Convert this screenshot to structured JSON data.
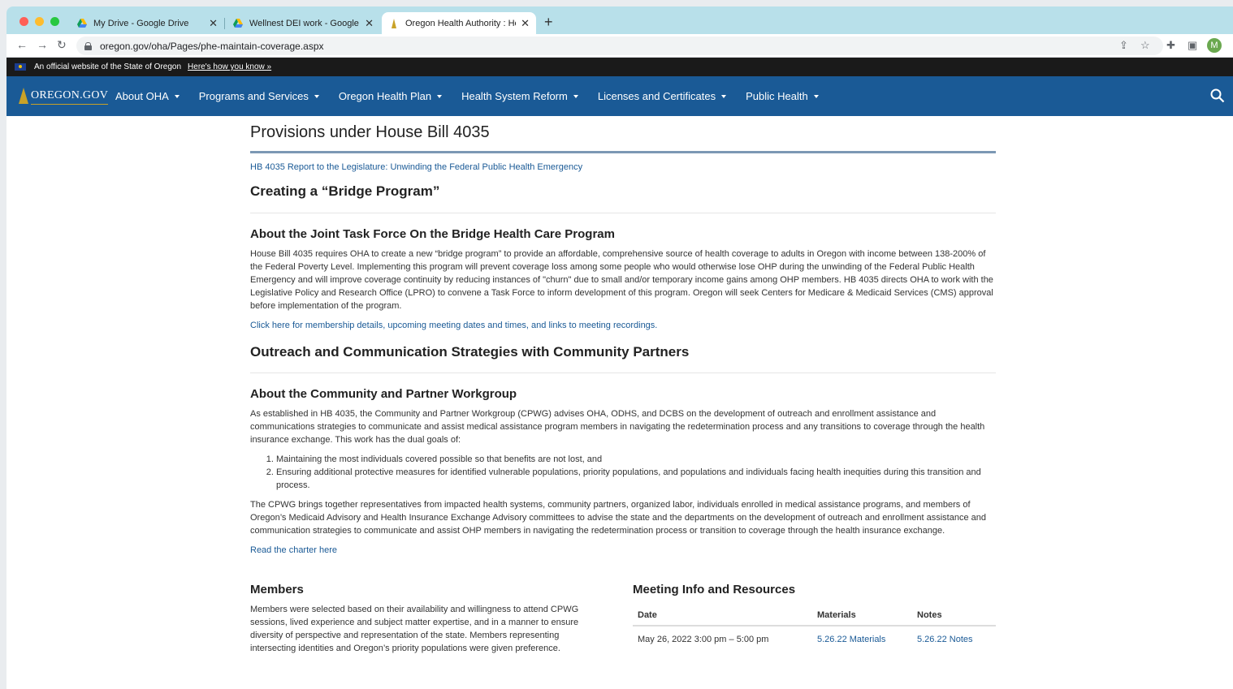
{
  "browser": {
    "tabs": [
      {
        "title": "My Drive - Google Drive",
        "active": false
      },
      {
        "title": "Wellnest DEI work - Google Dr",
        "active": false
      },
      {
        "title": "Oregon Health Authority : Help",
        "active": true
      }
    ],
    "new_tab": "+",
    "url": "oregon.gov/oha/Pages/phe-maintain-coverage.aspx",
    "avatar_letter": "M",
    "colors": {
      "tabstrip": "#b8e0ea",
      "avatar": "#6aa84f"
    }
  },
  "official_banner": {
    "text": "An official website of the State of Oregon",
    "link": "Here's how you know »"
  },
  "nav": {
    "logo_text": "OREGON.GOV",
    "items": [
      "About OHA",
      "Programs and Services",
      "Oregon Health Plan",
      "Health System Reform",
      "Licenses and Certificates",
      "Public Health"
    ],
    "color": "#1a5a96"
  },
  "content": {
    "title": "Provisions under House Bill 4035",
    "hb_link": "HB 4035 Report to the Legislature: Unwinding the Federal Public Health Emergency",
    "bridge_heading": "Creating a “Bridge Program”",
    "task_force_heading": "About the Joint Task Force On the Bridge Health Care Program",
    "task_force_text": "House Bill 4035 requires OHA to create a new “bridge program” to provide an affordable, comprehensive source of health coverage to adults in Oregon with income between 138-200% of the Federal Poverty Level. Implementing this program will prevent coverage loss among some people who would otherwise lose OHP during the unwinding of the Federal Public Health Emergency and will improve coverage continuity by reducing instances of \"churn\" due to small and/or temporary income gains among OHP members. HB 4035 directs OHA to work with the Legislative Policy and Research Office (LPRO) to convene a Task Force to inform development of this program. Oregon will seek Centers for Medicare & Medicaid Services (CMS) approval before implementation of the program.",
    "task_force_link": "Click here for membership details, upcoming meeting dates and times, and links to meeting recordings.",
    "outreach_heading": "Outreach and Communication Strategies with Community Partners",
    "workgroup_heading": "About the Community and Partner Workgroup",
    "workgroup_text": "As established in HB 4035, the Community and Partner Workgroup (CPWG) advises OHA, ODHS, and DCBS on the development of outreach and enrollment assistance and communications strategies to communicate and assist medical assistance program members in navigating the redetermination process and any transitions to coverage through the health insurance exchange. This work has the dual goals of:",
    "goals": [
      "Maintaining the most individuals covered possible so that benefits are not lost, and",
      "Ensuring additional protective measures for identified vulnerable populations, priority populations, and populations and individuals facing health inequities during this transition and process."
    ],
    "cpwg_text": "The CPWG brings together representatives from impacted health systems, community partners, organized labor, individuals enrolled in medical assistance programs, and members of Oregon’s Medicaid Advisory and Health Insurance Exchange Advisory committees to advise the state and the departments on the development of outreach and enrollment assistance and communication strategies to communicate and assist OHP members in navigating the redetermination process or transition to coverage through the health insurance exchange.",
    "charter_link": "Read the charter here",
    "members_heading": "Members",
    "members_text": "Members were selected based on their availability and willingness to attend CPWG sessions, lived experience and subject matter expertise, and in a manner to ensure diversity of perspective and representation of the state. Members representing intersecting identities and Oregon’s priority populations were given preference.",
    "meetings_heading": "Meeting Info and Resources",
    "table": {
      "headers": [
        "Date",
        "Materials",
        "Notes"
      ],
      "rows": [
        {
          "date": "May 26, 2022 3:00 pm – 5:00 pm",
          "materials": "5.26.22 Materials",
          "notes": "5.26.22 Notes"
        }
      ]
    }
  }
}
